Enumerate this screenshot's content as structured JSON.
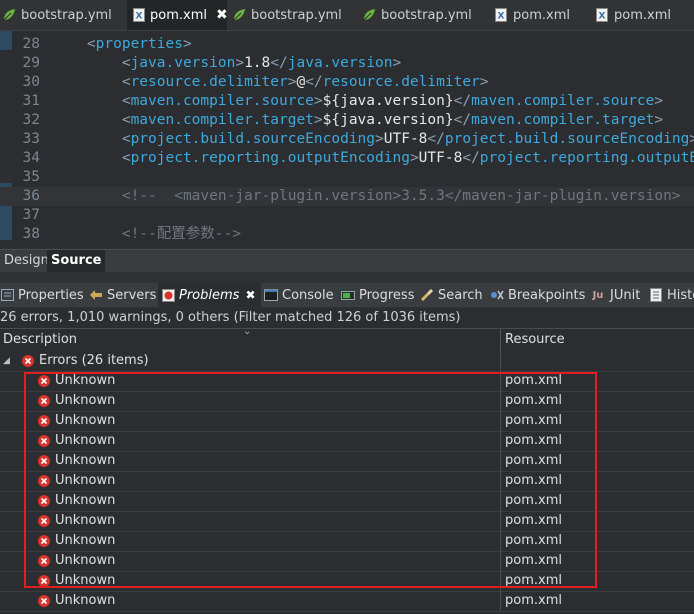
{
  "editor_tabs": [
    {
      "label": "bootstrap.yml",
      "icon": "spring-leaf-icon"
    },
    {
      "label": "pom.xml",
      "icon": "xml-file-icon",
      "active": true,
      "close": "✖"
    },
    {
      "label": "bootstrap.yml",
      "icon": "spring-leaf-icon"
    },
    {
      "label": "bootstrap.yml",
      "icon": "spring-leaf-icon"
    },
    {
      "label": "pom.xml",
      "icon": "xml-file-icon"
    },
    {
      "label": "pom.xml",
      "icon": "xml-file-icon"
    }
  ],
  "editor": {
    "lines": [
      {
        "num": "28",
        "indent": "    ",
        "tag": "properties",
        "value": "",
        "close": false
      },
      {
        "num": "29",
        "indent": "        ",
        "tag": "java.version",
        "value": "1.8",
        "close": true
      },
      {
        "num": "30",
        "indent": "        ",
        "tag": "resource.delimiter",
        "value": "@",
        "close": true
      },
      {
        "num": "31",
        "indent": "        ",
        "tag": "maven.compiler.source",
        "value": "${java.version}",
        "close": true
      },
      {
        "num": "32",
        "indent": "        ",
        "tag": "maven.compiler.target",
        "value": "${java.version}",
        "close": true
      },
      {
        "num": "33",
        "indent": "        ",
        "tag": "project.build.sourceEncoding",
        "value": "UTF-8",
        "close": true
      },
      {
        "num": "34",
        "indent": "        ",
        "tag": "project.reporting.outputEncoding",
        "value": "UTF-8",
        "close": true
      },
      {
        "num": "35",
        "text": ""
      },
      {
        "num": "36",
        "comment": "        <!--  <maven-jar-plugin.version>3.5.3</maven-jar-plugin.version>"
      },
      {
        "num": "37",
        "text": ""
      },
      {
        "num": "38",
        "comment": "        <!--配置参数-->"
      }
    ]
  },
  "view_tabs": {
    "design": "Design",
    "source": "Source"
  },
  "panel_tabs": [
    {
      "label": "Properties",
      "icon": "properties-icon"
    },
    {
      "label": "Servers",
      "icon": "servers-icon"
    },
    {
      "label": "Problems",
      "icon": "problems-icon",
      "active": true,
      "close": "✖"
    },
    {
      "label": "Console",
      "icon": "console-icon"
    },
    {
      "label": "Progress",
      "icon": "progress-icon"
    },
    {
      "label": "Search",
      "icon": "search-icon"
    },
    {
      "label": "Breakpoints",
      "icon": "breakpoints-icon"
    },
    {
      "label": "JUnit",
      "icon": "junit-icon"
    },
    {
      "label": "History",
      "icon": "history-icon"
    }
  ],
  "problems": {
    "summary": "26 errors, 1,010 warnings, 0 others (Filter matched 126 of 1036 items)",
    "columns": {
      "description": "Description",
      "resource": "Resource"
    },
    "group": {
      "label": "Errors (26 items)"
    },
    "rows": [
      {
        "description": "Unknown",
        "resource": "pom.xml"
      },
      {
        "description": "Unknown",
        "resource": "pom.xml"
      },
      {
        "description": "Unknown",
        "resource": "pom.xml"
      },
      {
        "description": "Unknown",
        "resource": "pom.xml"
      },
      {
        "description": "Unknown",
        "resource": "pom.xml"
      },
      {
        "description": "Unknown",
        "resource": "pom.xml"
      },
      {
        "description": "Unknown",
        "resource": "pom.xml"
      },
      {
        "description": "Unknown",
        "resource": "pom.xml"
      },
      {
        "description": "Unknown",
        "resource": "pom.xml"
      },
      {
        "description": "Unknown",
        "resource": "pom.xml"
      },
      {
        "description": "Unknown",
        "resource": "pom.xml"
      },
      {
        "description": "Unknown",
        "resource": "pom.xml"
      }
    ]
  },
  "colors": {
    "highlight": "#e02020",
    "error": "#d8332b",
    "tag": "#3ea9dc"
  }
}
